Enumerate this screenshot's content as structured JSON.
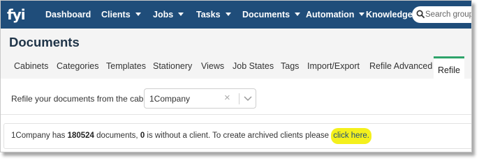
{
  "app": {
    "logo_text": "fyi"
  },
  "nav": {
    "items": [
      {
        "label": "Dashboard",
        "dropdown": false
      },
      {
        "label": "Clients",
        "dropdown": true
      },
      {
        "label": "Jobs",
        "dropdown": true
      },
      {
        "label": "Tasks",
        "dropdown": true
      },
      {
        "label": "Documents",
        "dropdown": true
      },
      {
        "label": "Automation",
        "dropdown": true
      },
      {
        "label": "Knowledge",
        "dropdown": false
      }
    ],
    "search_placeholder": "Search groups"
  },
  "page": {
    "title": "Documents"
  },
  "tabs": [
    {
      "label": "Cabinets",
      "active": false
    },
    {
      "label": "Categories",
      "active": false
    },
    {
      "label": "Templates",
      "active": false
    },
    {
      "label": "Stationery",
      "active": false
    },
    {
      "label": "Views",
      "active": false
    },
    {
      "label": "Job States",
      "active": false
    },
    {
      "label": "Tags",
      "active": false
    },
    {
      "label": "Import/Export",
      "active": false
    },
    {
      "label": "Refile Advanced",
      "active": false
    },
    {
      "label": "Refile",
      "active": true
    }
  ],
  "refile": {
    "cabinet_label": "Refile your documents from the cabinet:",
    "cabinet_value": "1Company",
    "info": {
      "cabinet_name": "1Company",
      "text_has": "has",
      "documents_count": "180524",
      "text_documents": "documents,",
      "without_client_count": "0",
      "text_rest": "is without a client. To create archived clients please",
      "link_text": "click here."
    }
  },
  "colors": {
    "nav_bg": "#1f4d7a",
    "active_tab_accent": "#2ea36a",
    "link_highlight": "#f4f01c"
  }
}
